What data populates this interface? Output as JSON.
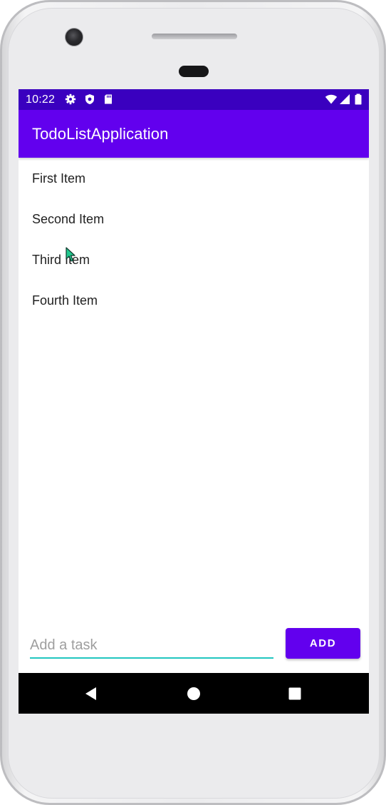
{
  "status_bar": {
    "time": "10:22",
    "icons_left": [
      "gear-icon",
      "shield-icon",
      "sd-card-icon"
    ],
    "icons_right": [
      "wifi-icon",
      "signal-icon",
      "battery-icon"
    ]
  },
  "app_bar": {
    "title": "TodoListApplication"
  },
  "list": {
    "items": [
      {
        "label": "First Item"
      },
      {
        "label": "Second Item"
      },
      {
        "label": "Third Item"
      },
      {
        "label": "Fourth Item"
      }
    ]
  },
  "input": {
    "value": "",
    "placeholder": "Add a task"
  },
  "add_button": {
    "label": "ADD"
  },
  "nav_bar": {
    "buttons": [
      "back-icon",
      "home-icon",
      "recents-icon"
    ]
  },
  "colors": {
    "status_bar": "#3a00bf",
    "primary": "#6200ee",
    "input_underline": "#21c6c0",
    "nav_bar": "#000000"
  }
}
